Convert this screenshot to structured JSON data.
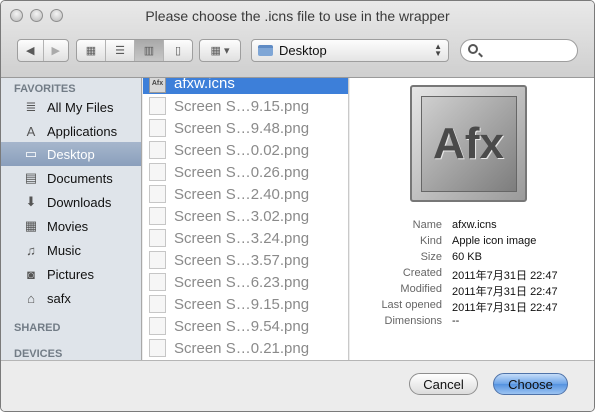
{
  "window": {
    "title": "Please choose the .icns file to use in the wrapper"
  },
  "toolbar": {
    "back_icon": "chevron-left-icon",
    "forward_icon": "chevron-right-icon",
    "location": "Desktop",
    "search_placeholder": ""
  },
  "sidebar": {
    "favorites_heading": "FAVORITES",
    "shared_heading": "SHARED",
    "devices_heading": "DEVICES",
    "items": [
      {
        "label": "All My Files",
        "icon": "files-icon",
        "glyph": "≣"
      },
      {
        "label": "Applications",
        "icon": "applications-icon",
        "glyph": "A"
      },
      {
        "label": "Desktop",
        "icon": "desktop-icon",
        "glyph": "▭"
      },
      {
        "label": "Documents",
        "icon": "documents-icon",
        "glyph": "▤"
      },
      {
        "label": "Downloads",
        "icon": "downloads-icon",
        "glyph": "⬇"
      },
      {
        "label": "Movies",
        "icon": "movies-icon",
        "glyph": "▦"
      },
      {
        "label": "Music",
        "icon": "music-icon",
        "glyph": "♫"
      },
      {
        "label": "Pictures",
        "icon": "pictures-icon",
        "glyph": "◙"
      },
      {
        "label": "safx",
        "icon": "home-icon",
        "glyph": "⌂"
      }
    ]
  },
  "files": [
    {
      "name": "afxw.icns",
      "icon_text": "Afx"
    },
    {
      "name": "Screen S…9.15.png"
    },
    {
      "name": "Screen S…9.48.png"
    },
    {
      "name": "Screen S…0.02.png"
    },
    {
      "name": "Screen S…0.26.png"
    },
    {
      "name": "Screen S…2.40.png"
    },
    {
      "name": "Screen S…3.02.png"
    },
    {
      "name": "Screen S…3.24.png"
    },
    {
      "name": "Screen S…3.57.png"
    },
    {
      "name": "Screen S…6.23.png"
    },
    {
      "name": "Screen S…9.15.png"
    },
    {
      "name": "Screen S…9.54.png"
    },
    {
      "name": "Screen S…0.21.png"
    }
  ],
  "preview": {
    "icon_text": "Afx",
    "rows": [
      {
        "label": "Name",
        "value": "afxw.icns"
      },
      {
        "label": "Kind",
        "value": "Apple icon image"
      },
      {
        "label": "Size",
        "value": "60 KB"
      },
      {
        "label": "Created",
        "value": "2011年7月31日 22:47"
      },
      {
        "label": "Modified",
        "value": "2011年7月31日 22:47"
      },
      {
        "label": "Last opened",
        "value": "2011年7月31日 22:47"
      },
      {
        "label": "Dimensions",
        "value": "--"
      }
    ]
  },
  "buttons": {
    "cancel": "Cancel",
    "choose": "Choose"
  }
}
